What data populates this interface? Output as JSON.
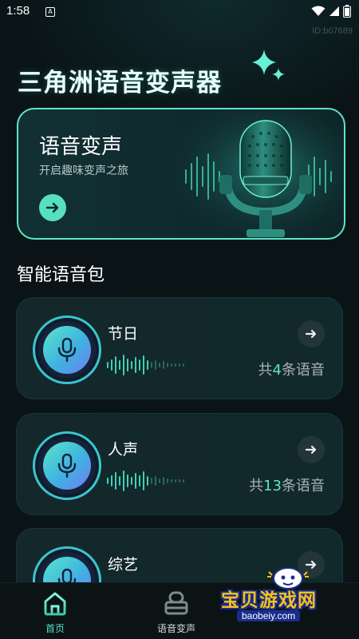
{
  "status_bar": {
    "time": "1:58",
    "notification_icon": "A",
    "icons": [
      "wifi-icon",
      "signal-icon",
      "battery-icon"
    ]
  },
  "id_label": "ID:b07689",
  "app_title": "三角洲语音变声器",
  "banner": {
    "title": "语音变声",
    "subtitle": "开启趣味变声之旅"
  },
  "section_title": "智能语音包",
  "cards": [
    {
      "name": "节日",
      "count_prefix": "共",
      "count": "4",
      "count_suffix": "条语音"
    },
    {
      "name": "人声",
      "count_prefix": "共",
      "count": "13",
      "count_suffix": "条语音"
    },
    {
      "name": "综艺",
      "count_prefix": "",
      "count": "",
      "count_suffix": ""
    }
  ],
  "bottom_nav": {
    "items": [
      {
        "label": "首页",
        "active": true
      },
      {
        "label": "语音变声",
        "active": false
      }
    ]
  },
  "watermark": {
    "text": "宝贝游戏网",
    "url": "baobeiy.com"
  },
  "colors": {
    "accent": "#56e0c0",
    "background": "#0a1416",
    "card": "#13282b",
    "muted": "#a9b3b4"
  }
}
